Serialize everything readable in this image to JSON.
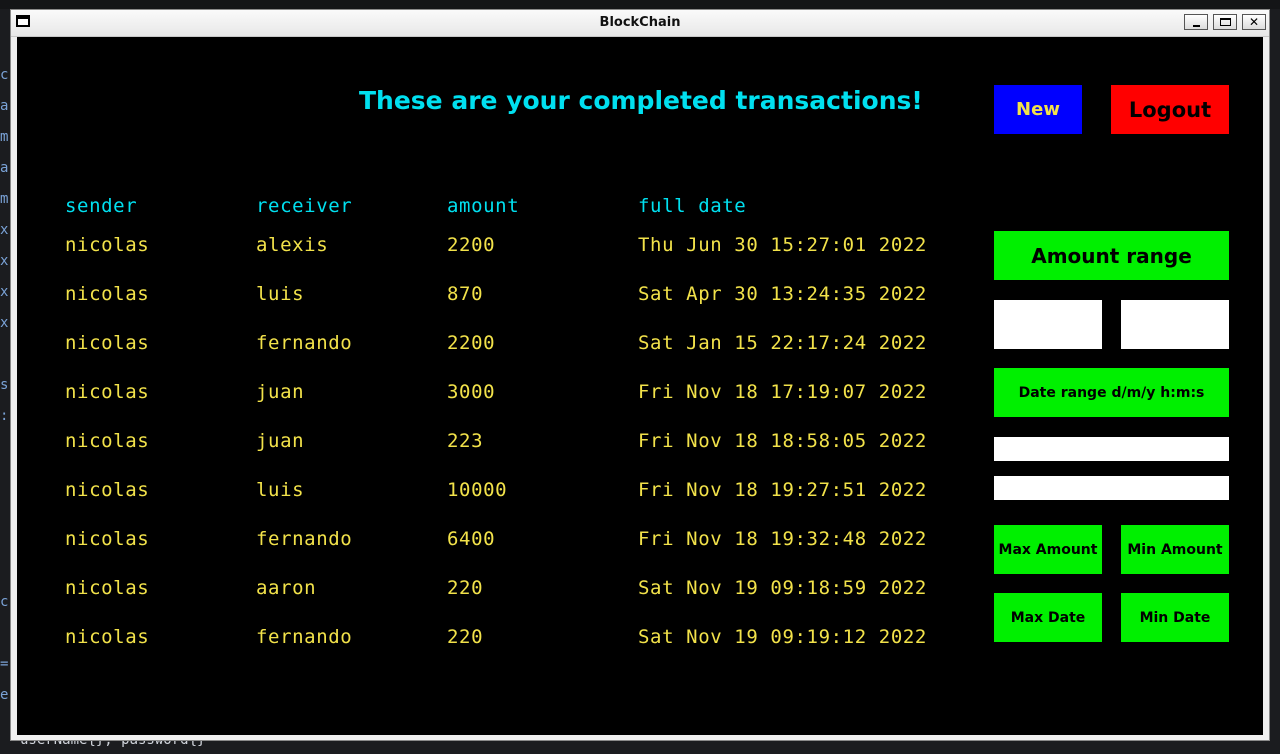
{
  "window": {
    "title": "BlockChain"
  },
  "background": {
    "gutter_chars": [
      "c",
      "a",
      "m",
      "a",
      "m",
      "x",
      "x",
      "x",
      "x",
      "",
      "s",
      ":",
      "",
      "",
      "",
      "",
      "",
      "c",
      "",
      "=",
      "e"
    ],
    "bottom_code": "userName{}, password{}"
  },
  "header": {
    "heading": "These are your completed transactions!",
    "new_label": "New",
    "logout_label": "Logout"
  },
  "table": {
    "columns": [
      "sender",
      "receiver",
      "amount",
      "full date"
    ],
    "rows": [
      [
        "nicolas",
        "alexis",
        "2200",
        "Thu Jun 30 15:27:01 2022"
      ],
      [
        "nicolas",
        "luis",
        "870",
        "Sat Apr 30 13:24:35 2022"
      ],
      [
        "nicolas",
        "fernando",
        "2200",
        "Sat Jan 15 22:17:24 2022"
      ],
      [
        "nicolas",
        "juan",
        "3000",
        "Fri Nov 18 17:19:07 2022"
      ],
      [
        "nicolas",
        "juan",
        "223",
        "Fri Nov 18 18:58:05 2022"
      ],
      [
        "nicolas",
        "luis",
        "10000",
        "Fri Nov 18 19:27:51 2022"
      ],
      [
        "nicolas",
        "fernando",
        "6400",
        "Fri Nov 18 19:32:48 2022"
      ],
      [
        "nicolas",
        "aaron",
        "220",
        "Sat Nov 19 09:18:59 2022"
      ],
      [
        "nicolas",
        "fernando",
        "220",
        "Sat Nov 19 09:19:12 2022"
      ]
    ]
  },
  "filters": {
    "amount_range_label": "Amount range",
    "amount_min_value": "",
    "amount_max_value": "",
    "date_range_label": "Date range d/m/y h:m:s",
    "date_from_value": "",
    "date_to_value": "",
    "max_amount_label": "Max Amount",
    "min_amount_label": "Min Amount",
    "max_date_label": "Max Date",
    "min_date_label": "Min Date"
  },
  "colors": {
    "heading": "#00e0f0",
    "row_text": "#f2e24a",
    "new_button": "#0000ff",
    "logout_button": "#ff0000",
    "filter_buttons": "#00f000",
    "client_background": "#000000"
  },
  "icons": {
    "window_icon": "window-app-icon",
    "minimize": "minimize-icon",
    "maximize": "maximize-icon",
    "close": "close-icon"
  }
}
